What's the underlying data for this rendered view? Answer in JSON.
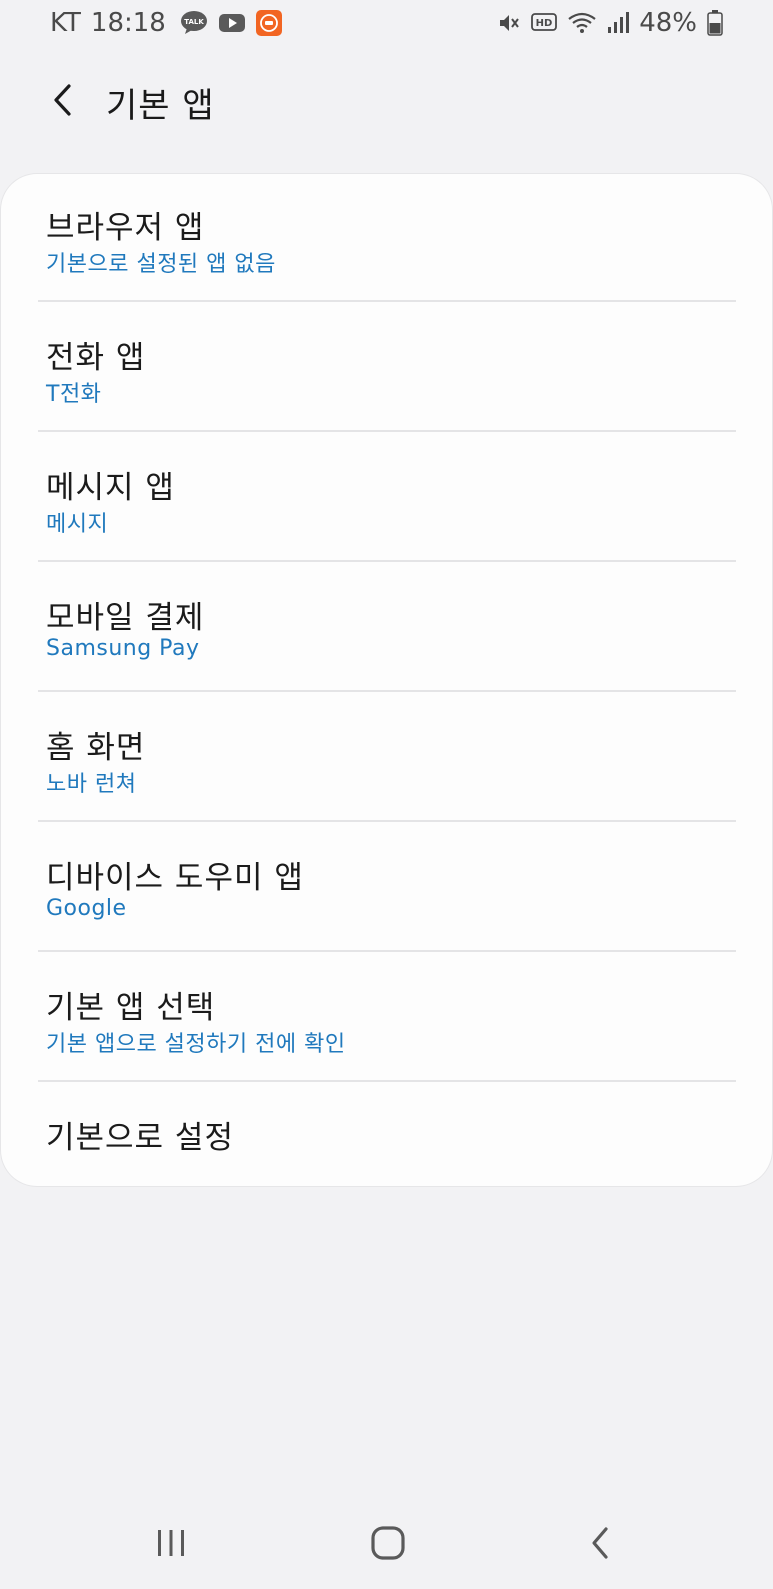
{
  "status_bar": {
    "carrier": "KT",
    "time": "18:18",
    "battery": "48%",
    "left_icons": [
      "kakaotalk-icon",
      "youtube-icon",
      "app-notification-icon"
    ],
    "right_icons": [
      "mute-icon",
      "hd-voice-icon",
      "wifi-icon",
      "signal-icon",
      "battery-icon"
    ]
  },
  "header": {
    "title": "기본 앱"
  },
  "items": [
    {
      "title": "브라우저 앱",
      "subtitle": "기본으로 설정된 앱 없음"
    },
    {
      "title": "전화 앱",
      "subtitle": "T전화"
    },
    {
      "title": "메시지 앱",
      "subtitle": "메시지"
    },
    {
      "title": "모바일 결제",
      "subtitle": "Samsung Pay"
    },
    {
      "title": "홈 화면",
      "subtitle": "노바 런쳐"
    },
    {
      "title": "디바이스 도우미 앱",
      "subtitle": "Google"
    },
    {
      "title": "기본 앱 선택",
      "subtitle": "기본 앱으로 설정하기 전에 확인"
    },
    {
      "title": "기본으로 설정",
      "subtitle": ""
    }
  ],
  "colors": {
    "background": "#f2f2f4",
    "card": "#fdfdfd",
    "accent": "#2079bd",
    "divider": "#e4e4e6",
    "text": "#1b1b1b"
  },
  "nav_bar": {
    "icons": [
      "recent-apps-icon",
      "home-icon",
      "back-icon"
    ]
  }
}
